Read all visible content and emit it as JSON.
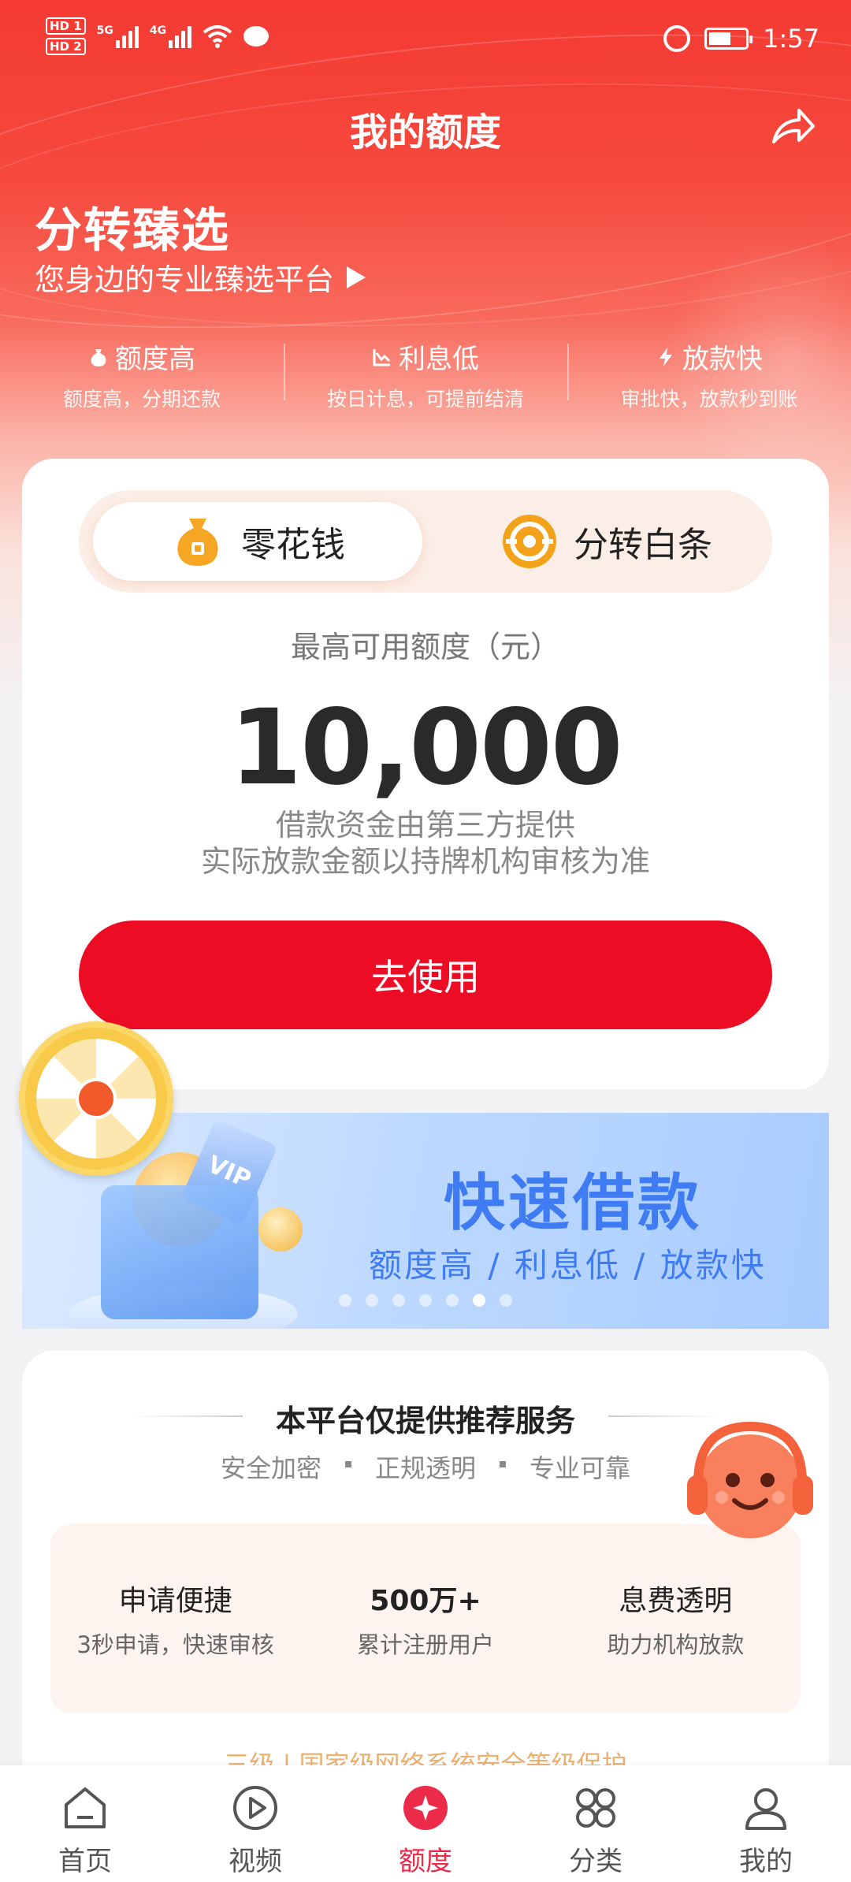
{
  "status_bar": {
    "time": "1:57",
    "sim1": "HD 1",
    "sim2": "HD 2",
    "net1": "5G",
    "net2": "4G"
  },
  "header": {
    "title": "我的额度",
    "share_icon": "share-arrow-icon"
  },
  "hero": {
    "brand": "分转臻选",
    "tagline": "您身边的专业臻选平台",
    "features": [
      {
        "title": "额度高",
        "subtitle": "额度高，分期还款",
        "icon": "money-bag-icon"
      },
      {
        "title": "利息低",
        "subtitle": "按日计息，可提前结清",
        "icon": "chart-down-icon"
      },
      {
        "title": "放款快",
        "subtitle": "审批快，放款秒到账",
        "icon": "lightning-icon"
      }
    ]
  },
  "limit_card": {
    "tabs": [
      {
        "label": "零花钱",
        "active": true,
        "icon": "money-bag-icon"
      },
      {
        "label": "分转白条",
        "active": false,
        "icon": "target-coin-icon"
      }
    ],
    "limit_label": "最高可用额度（元）",
    "limit_amount": "10,000",
    "note_line1": "借款资金由第三方提供",
    "note_line2": "实际放款金额以持牌机构审核为准",
    "use_button": "去使用"
  },
  "banner": {
    "title": "快速借款",
    "subtitle": "额度高 / 利息低 / 放款快",
    "vip_text": "VIP",
    "slide_count": 7,
    "active_slide": 6
  },
  "service": {
    "title": "本平台仅提供推荐服务",
    "tags": [
      "安全加密",
      "正规透明",
      "专业可靠"
    ],
    "items": [
      {
        "title": "申请便捷",
        "subtitle": "3秒申请，快速审核",
        "bold": false
      },
      {
        "title": "500万+",
        "subtitle": "累计注册用户",
        "bold": true
      },
      {
        "title": "息费透明",
        "subtitle": "助力机构放款",
        "bold": false
      }
    ],
    "footer": "三级  |  国家级网络系统安全等级保护"
  },
  "bottom_nav": [
    {
      "label": "首页",
      "icon": "home-icon",
      "active": false
    },
    {
      "label": "视频",
      "icon": "play-icon",
      "active": false
    },
    {
      "label": "额度",
      "icon": "quota-icon",
      "active": true
    },
    {
      "label": "分类",
      "icon": "category-icon",
      "active": false
    },
    {
      "label": "我的",
      "icon": "profile-icon",
      "active": false
    }
  ],
  "colors": {
    "brand_red": "#ec0d25",
    "hero_red": "#f43a32",
    "banner_blue": "#3f7bf2",
    "nav_active": "#ec2b4a"
  }
}
